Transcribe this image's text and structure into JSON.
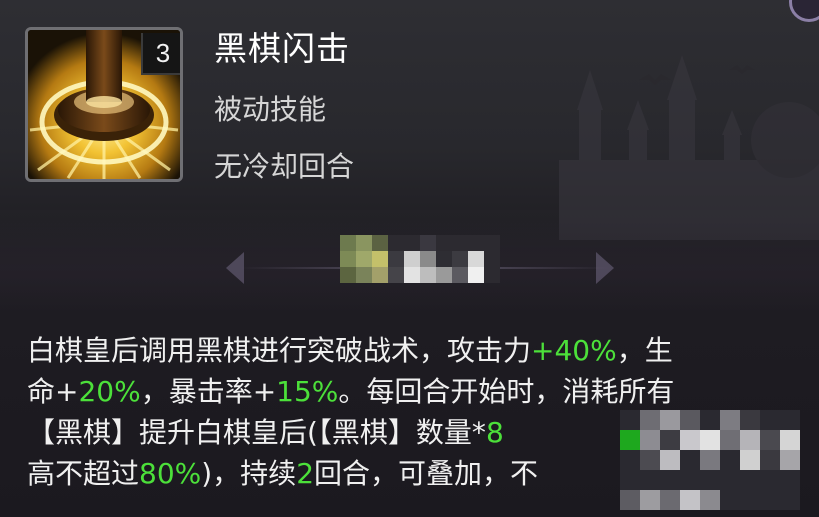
{
  "skill": {
    "name": "黑棋闪击",
    "level": "3",
    "type": "被动技能",
    "cooldown": "无冷却回合"
  },
  "description": {
    "lines": [
      [
        {
          "text": "白棋皇后调用黑棋进行突破战术，攻击力",
          "green": false
        },
        {
          "text": "+40%",
          "green": true
        },
        {
          "text": "，生",
          "green": false
        }
      ],
      [
        {
          "text": "命+",
          "green": false
        },
        {
          "text": "20%",
          "green": true
        },
        {
          "text": "，暴击率+",
          "green": false
        },
        {
          "text": "15%",
          "green": true
        },
        {
          "text": "。每回合开始时，消耗所有",
          "green": false
        }
      ],
      [
        {
          "text": "【黑棋】提升白棋皇后(【黑棋】数量*",
          "green": false
        },
        {
          "text": "8",
          "green": true
        }
      ],
      [
        {
          "text": "高不超过",
          "green": false
        },
        {
          "text": "80%",
          "green": true
        },
        {
          "text": ")，持续",
          "green": false
        },
        {
          "text": "2",
          "green": true
        },
        {
          "text": "回合，可叠加，不",
          "green": false
        }
      ]
    ]
  },
  "colors": {
    "highlight": "#4ce03a",
    "text": "#f0f0f0",
    "background": "#232227"
  },
  "icons": {
    "skill_icon": "black-chess-piece-icon",
    "corner": "ring-icon"
  }
}
